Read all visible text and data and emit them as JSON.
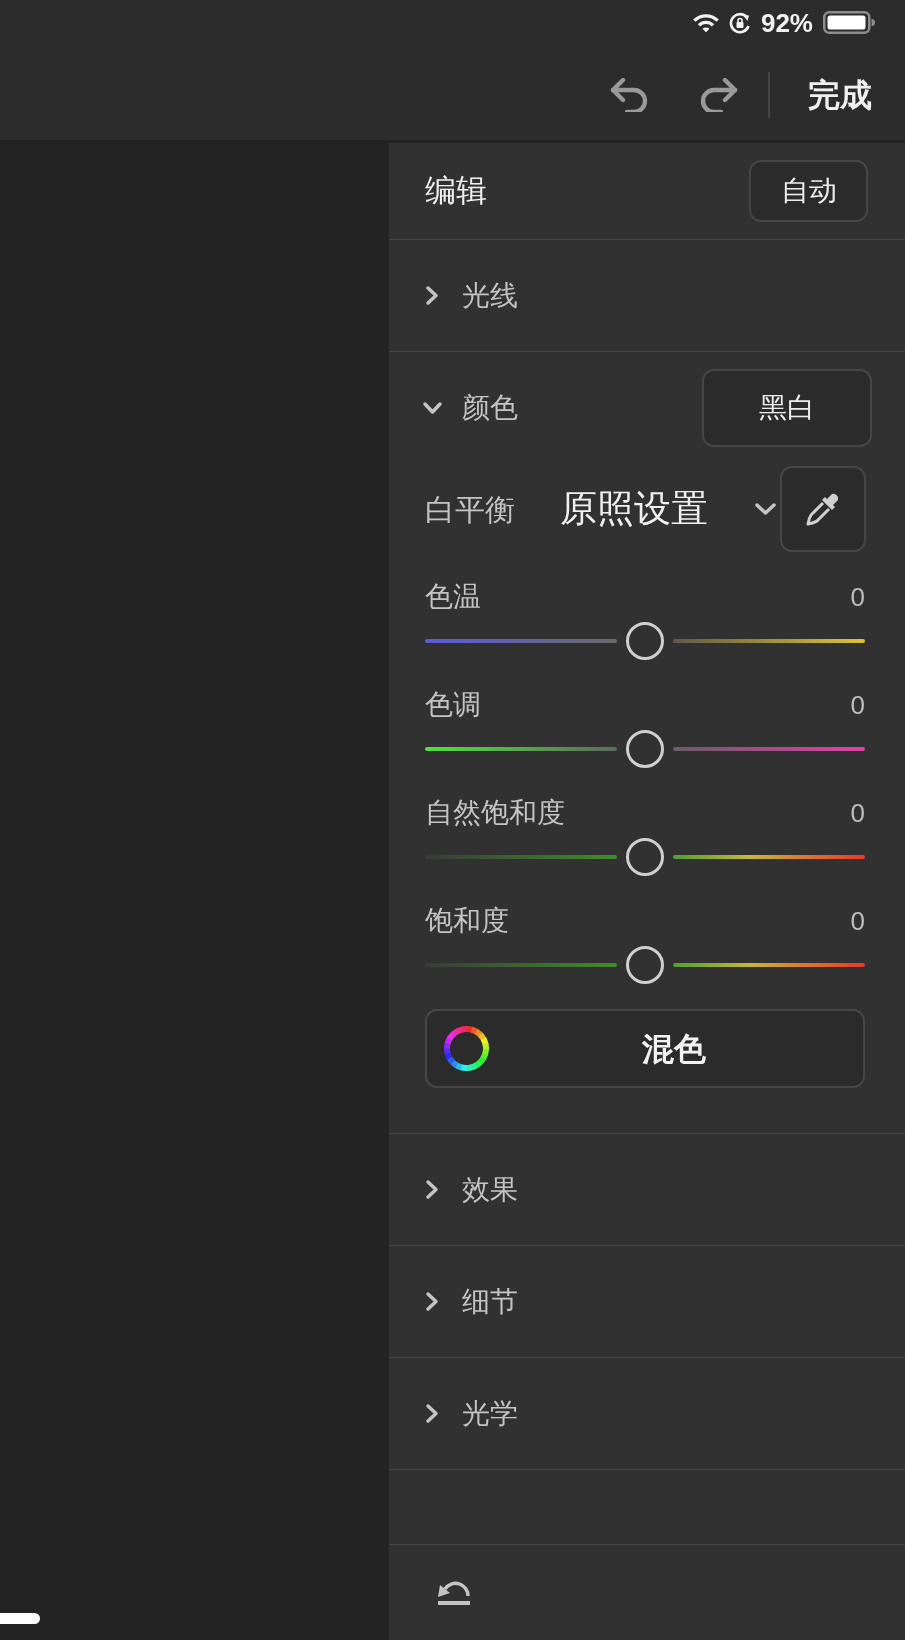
{
  "status_bar": {
    "battery": "92%"
  },
  "toolbar": {
    "done_button": "完成"
  },
  "panel": {
    "title": "编辑",
    "auto_button": "自动"
  },
  "sections": [
    {
      "label": "光线",
      "expanded": false
    },
    {
      "label": "颜色",
      "expanded": true,
      "bw_button": "黑白",
      "white_balance": {
        "label": "白平衡",
        "value": "原照设置"
      },
      "sliders": [
        {
          "kind": "temperature",
          "label": "色温",
          "value": "0",
          "level": 0.5
        },
        {
          "kind": "tint",
          "label": "色调",
          "value": "0",
          "level": 0.5
        },
        {
          "kind": "vibrance",
          "label": "自然饱和度",
          "value": "0",
          "level": 0.5
        },
        {
          "kind": "saturation",
          "label": "饱和度",
          "value": "0",
          "level": 0.5
        }
      ],
      "mix_button": "混色"
    },
    {
      "label": "效果",
      "expanded": false
    },
    {
      "label": "细节",
      "expanded": false
    },
    {
      "label": "光学",
      "expanded": false
    }
  ]
}
